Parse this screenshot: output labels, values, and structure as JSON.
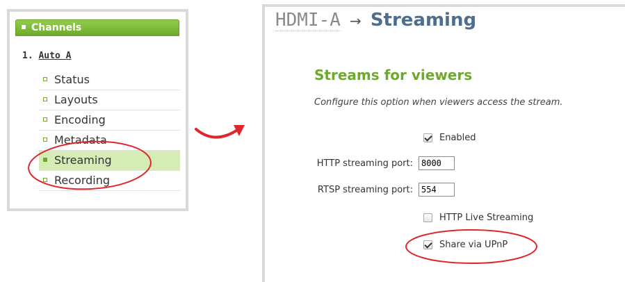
{
  "sidebar": {
    "header": "Channels",
    "channel_label": "1. Auto A",
    "channel_index": "1.",
    "channel_link": "Auto A",
    "items": [
      {
        "label": "Status",
        "active": false
      },
      {
        "label": "Layouts",
        "active": false
      },
      {
        "label": "Encoding",
        "active": false
      },
      {
        "label": "Metadata",
        "active": false
      },
      {
        "label": "Streaming",
        "active": true
      },
      {
        "label": "Recording",
        "active": false
      }
    ]
  },
  "page": {
    "breadcrumb_source": "HDMI-A",
    "breadcrumb_arrow": "→",
    "title": "Streaming"
  },
  "section": {
    "title": "Streams for viewers",
    "description": "Configure this option when viewers access the stream."
  },
  "form": {
    "enabled": {
      "label": "Enabled",
      "checked": true
    },
    "http_port": {
      "label": "HTTP streaming port:",
      "value": "8000"
    },
    "rtsp_port": {
      "label": "RTSP streaming port:",
      "value": "554"
    },
    "hls": {
      "label": "HTTP Live Streaming",
      "checked": false
    },
    "upnp": {
      "label": "Share via UPnP",
      "checked": true
    }
  },
  "colors": {
    "accent_green": "#6ea92d",
    "active_row_bg": "#d6ecb6",
    "annotation_red": "#e0262c",
    "title_blue": "#4d6e8c"
  }
}
